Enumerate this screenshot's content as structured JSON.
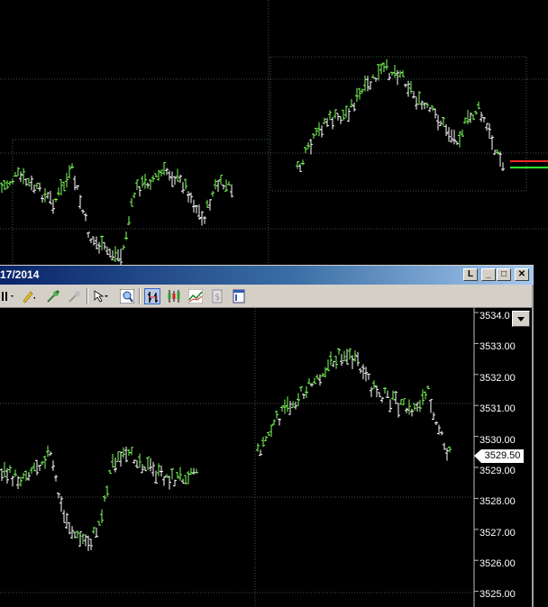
{
  "window": {
    "title": "17/2014",
    "buttons": {
      "lock": "L",
      "minimize": "_",
      "maximize": "□",
      "close": "✕"
    }
  },
  "toolbar": {
    "tools": [
      {
        "name": "bar-style-icon"
      },
      {
        "name": "pencil-icon"
      },
      {
        "name": "zoom-in-icon"
      },
      {
        "name": "zoom-out-icon"
      },
      {
        "name": "cursor-icon"
      },
      {
        "name": "magnify-icon"
      },
      {
        "name": "bar-chart-type-icon"
      },
      {
        "name": "candlestick-icon"
      },
      {
        "name": "line-chart-icon"
      },
      {
        "name": "dollar-icon"
      },
      {
        "name": "properties-icon"
      }
    ]
  },
  "price_axis": {
    "labels": [
      "3534.0",
      "3533.00",
      "3532.00",
      "3531.00",
      "3530.00",
      "3529.00",
      "3528.00",
      "3527.00",
      "3526.00",
      "3525.00"
    ],
    "last_price": "3529.50"
  },
  "colors": {
    "up": "#7dff5a",
    "down": "#ffffff",
    "grid": "#4a4a4a",
    "bid": "#ff2a2a",
    "ask": "#2aff2a",
    "accent": "#0a246a"
  }
}
